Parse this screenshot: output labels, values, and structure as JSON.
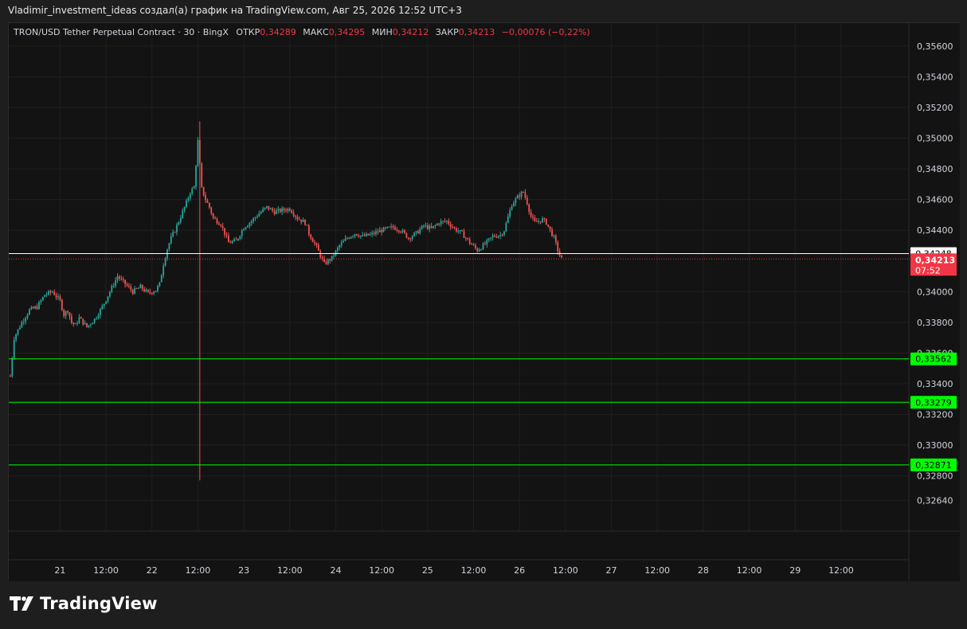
{
  "header": {
    "caption": "Vladimir_investment_ideas создал(а) график на TradingView.com, Авг 25, 2026 12:52 UTC+3"
  },
  "legend": {
    "symbol": "TRON/USD Tether Perpetual Contract · 30 · BingX",
    "open_label": "ОТКР",
    "open": "0,34289",
    "high_label": "МАКС",
    "high": "0,34295",
    "low_label": "МИН",
    "low": "0,34212",
    "close_label": "ЗАКР",
    "close": "0,34213",
    "change": "−0,00076 (−0,22%)"
  },
  "brand": {
    "name": "TradingView"
  },
  "colors": {
    "up": "#26a69a",
    "down": "#ef5350",
    "level": "#00ff00",
    "price_tag": "#f23645",
    "background": "#131313",
    "grid": "#1f1f1f"
  },
  "chart_data": {
    "type": "candlestick",
    "y_ticks": [
      "0,35600",
      "0,35400",
      "0,35200",
      "0,35000",
      "0,34800",
      "0,34600",
      "0,34400",
      "0,34000",
      "0,33800",
      "0,33600",
      "0,33400",
      "0,33200",
      "0,33000",
      "0,32800",
      "0,32640"
    ],
    "y_tick_values": [
      0.356,
      0.354,
      0.352,
      0.35,
      0.348,
      0.346,
      0.344,
      0.34,
      0.338,
      0.336,
      0.334,
      0.332,
      0.33,
      0.328,
      0.3264
    ],
    "ylim": [
      0.3244,
      0.3575
    ],
    "x_ticks": [
      "21",
      "12:00",
      "22",
      "12:00",
      "23",
      "12:00",
      "24",
      "12:00",
      "25",
      "12:00",
      "26",
      "12:00",
      "27",
      "12:00",
      "28",
      "12:00",
      "29",
      "12:00"
    ],
    "x_tick_hours": [
      0,
      12,
      24,
      36,
      48,
      60,
      72,
      84,
      96,
      108,
      120,
      132,
      144,
      156,
      168,
      180,
      192,
      204
    ],
    "xlim_hours": [
      -13.4,
      221.7
    ],
    "price_path": [
      [
        -13.0,
        0.3345
      ],
      [
        -12,
        0.337
      ],
      [
        -10,
        0.338
      ],
      [
        -8,
        0.3388
      ],
      [
        -6,
        0.339
      ],
      [
        -4,
        0.3398
      ],
      [
        -2,
        0.34
      ],
      [
        0,
        0.3394
      ],
      [
        1,
        0.3385
      ],
      [
        2,
        0.3388
      ],
      [
        3,
        0.338
      ],
      [
        4,
        0.3378
      ],
      [
        5,
        0.3383
      ],
      [
        7,
        0.3377
      ],
      [
        9,
        0.3382
      ],
      [
        11,
        0.339
      ],
      [
        13,
        0.34
      ],
      [
        15,
        0.341
      ],
      [
        17,
        0.3405
      ],
      [
        19,
        0.34
      ],
      [
        21,
        0.3403
      ],
      [
        23,
        0.3399
      ],
      [
        25,
        0.3401
      ],
      [
        26,
        0.3405
      ],
      [
        27,
        0.3418
      ],
      [
        28,
        0.3428
      ],
      [
        29,
        0.3435
      ],
      [
        30,
        0.344
      ],
      [
        32,
        0.3452
      ],
      [
        33,
        0.3458
      ],
      [
        34,
        0.3465
      ],
      [
        35,
        0.3468
      ],
      [
        36,
        0.3498
      ],
      [
        37,
        0.3467
      ],
      [
        38,
        0.346
      ],
      [
        39,
        0.3455
      ],
      [
        40,
        0.3448
      ],
      [
        42,
        0.3444
      ],
      [
        44,
        0.3432
      ],
      [
        46,
        0.3433
      ],
      [
        48,
        0.3442
      ],
      [
        50,
        0.3446
      ],
      [
        52,
        0.3451
      ],
      [
        54,
        0.3455
      ],
      [
        56,
        0.3452
      ],
      [
        58,
        0.3453
      ],
      [
        60,
        0.3454
      ],
      [
        62,
        0.3448
      ],
      [
        64,
        0.3445
      ],
      [
        65,
        0.3438
      ],
      [
        67,
        0.3429
      ],
      [
        69,
        0.3418
      ],
      [
        71,
        0.3422
      ],
      [
        73,
        0.343
      ],
      [
        75,
        0.3435
      ],
      [
        77,
        0.3438
      ],
      [
        79,
        0.3436
      ],
      [
        81,
        0.3437
      ],
      [
        84,
        0.344
      ],
      [
        87,
        0.3442
      ],
      [
        89,
        0.344
      ],
      [
        91,
        0.3435
      ],
      [
        93,
        0.3438
      ],
      [
        95,
        0.3443
      ],
      [
        97,
        0.3441
      ],
      [
        99,
        0.3445
      ],
      [
        101,
        0.3446
      ],
      [
        103,
        0.3441
      ],
      [
        105,
        0.3438
      ],
      [
        107,
        0.3432
      ],
      [
        109,
        0.3427
      ],
      [
        111,
        0.3431
      ],
      [
        113,
        0.3436
      ],
      [
        115,
        0.3437
      ],
      [
        116,
        0.344
      ],
      [
        118,
        0.3457
      ],
      [
        120,
        0.3463
      ],
      [
        121,
        0.3465
      ],
      [
        122,
        0.3458
      ],
      [
        123,
        0.3449
      ],
      [
        124,
        0.3445
      ],
      [
        126,
        0.3447
      ],
      [
        127,
        0.3445
      ],
      [
        128,
        0.344
      ],
      [
        129,
        0.3435
      ],
      [
        130,
        0.3427
      ],
      [
        131,
        0.3421
      ]
    ],
    "spike": {
      "hour": 36.5,
      "high": 0.3511,
      "low": 0.3277
    },
    "horizontal_lines": [
      {
        "label": "0,34248",
        "value": 0.34248,
        "color": "#ffffff",
        "style": "solid"
      },
      {
        "label": "0,33562",
        "value": 0.33562,
        "color": "#00ff00",
        "style": "solid"
      },
      {
        "label": "0,33279",
        "value": 0.33279,
        "color": "#00ff00",
        "style": "solid"
      },
      {
        "label": "0,32871",
        "value": 0.32871,
        "color": "#00ff00",
        "style": "solid"
      }
    ],
    "last_price": {
      "label": "0,34213",
      "value": 0.34213,
      "countdown": "07:52"
    },
    "grid": true
  }
}
